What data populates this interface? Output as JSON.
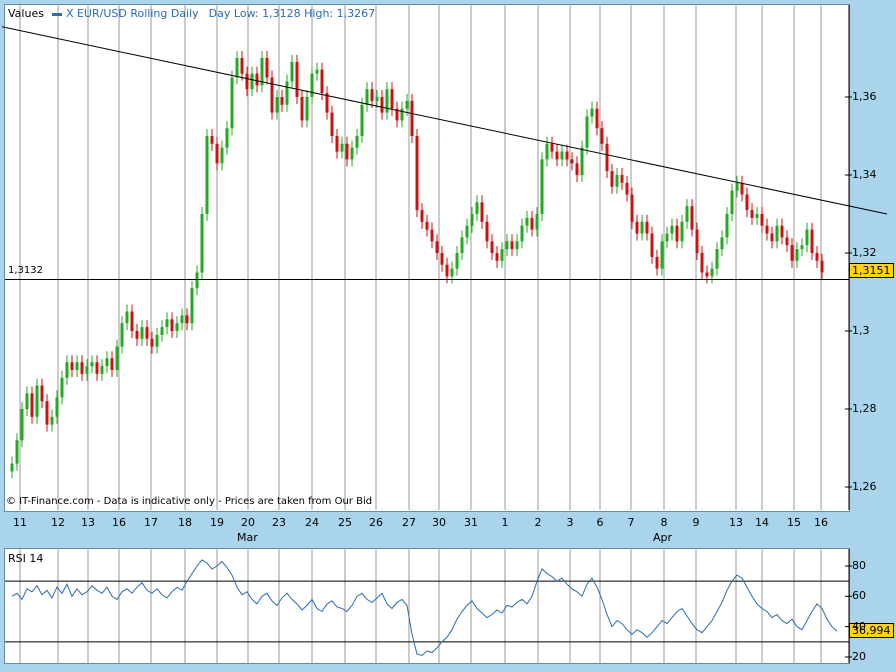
{
  "legend": {
    "title": "Values",
    "series": "X EUR/USD Rolling Daily",
    "day_info": "Day Low: 1,3128 High: 1,3267"
  },
  "footnote": "© IT-Finance.com - Data is indicative only - Prices are taken from Our Bid",
  "level_label": "1,3132",
  "last_price": "1,3151",
  "rsi": {
    "title": "RSI 14",
    "last": "36,994",
    "ticks": [
      "80",
      "60",
      "40",
      "20"
    ]
  },
  "colors": {
    "up": "#22aa22",
    "down": "#cc1111",
    "rsi_line": "#2a6cb0",
    "background": "#a9d4ec"
  },
  "chart_data": [
    {
      "type": "candlestick",
      "title": "X EUR/USD Rolling Daily",
      "yticks": [
        "1,36",
        "1,34",
        "1,32",
        "1,3",
        "1,28",
        "1,26"
      ],
      "ylim": [
        1.258,
        1.381
      ],
      "x_tick_labels": [
        "11",
        "12",
        "13",
        "16",
        "17",
        "18",
        "19",
        "20",
        "23",
        "24",
        "25",
        "26",
        "27",
        "30",
        "31",
        "1",
        "2",
        "3",
        "6",
        "7",
        "8",
        "9",
        "13",
        "14",
        "15",
        "16"
      ],
      "months": [
        "Mar",
        "Apr"
      ],
      "grid": true,
      "close_path": [
        [
          0,
          1.266
        ],
        [
          1,
          1.272
        ],
        [
          2,
          1.28
        ],
        [
          3,
          1.284
        ],
        [
          4,
          1.278
        ],
        [
          5,
          1.286
        ],
        [
          6,
          1.282
        ],
        [
          7,
          1.276
        ],
        [
          8,
          1.278
        ],
        [
          9,
          1.283
        ],
        [
          10,
          1.288
        ],
        [
          11,
          1.292
        ],
        [
          12,
          1.29
        ],
        [
          13,
          1.292
        ],
        [
          14,
          1.289
        ],
        [
          15,
          1.291
        ],
        [
          16,
          1.292
        ],
        [
          17,
          1.289
        ],
        [
          18,
          1.291
        ],
        [
          19,
          1.293
        ],
        [
          20,
          1.29
        ],
        [
          21,
          1.296
        ],
        [
          22,
          1.302
        ],
        [
          23,
          1.305
        ],
        [
          24,
          1.3
        ],
        [
          25,
          1.298
        ],
        [
          26,
          1.301
        ],
        [
          27,
          1.298
        ],
        [
          28,
          1.296
        ],
        [
          29,
          1.299
        ],
        [
          30,
          1.301
        ],
        [
          31,
          1.303
        ],
        [
          32,
          1.3
        ],
        [
          33,
          1.302
        ],
        [
          34,
          1.304
        ],
        [
          35,
          1.302
        ],
        [
          36,
          1.311
        ],
        [
          37,
          1.315
        ],
        [
          38,
          1.33
        ],
        [
          39,
          1.35
        ],
        [
          40,
          1.348
        ],
        [
          41,
          1.343
        ],
        [
          42,
          1.347
        ],
        [
          43,
          1.352
        ],
        [
          44,
          1.365
        ],
        [
          45,
          1.37
        ],
        [
          46,
          1.366
        ],
        [
          47,
          1.362
        ],
        [
          48,
          1.366
        ],
        [
          49,
          1.363
        ],
        [
          50,
          1.37
        ],
        [
          51,
          1.365
        ],
        [
          52,
          1.356
        ],
        [
          53,
          1.36
        ],
        [
          54,
          1.358
        ],
        [
          55,
          1.364
        ],
        [
          56,
          1.369
        ],
        [
          57,
          1.36
        ],
        [
          58,
          1.354
        ],
        [
          59,
          1.36
        ],
        [
          60,
          1.366
        ],
        [
          61,
          1.367
        ],
        [
          62,
          1.361
        ],
        [
          63,
          1.356
        ],
        [
          64,
          1.35
        ],
        [
          65,
          1.346
        ],
        [
          66,
          1.348
        ],
        [
          67,
          1.344
        ],
        [
          68,
          1.347
        ],
        [
          69,
          1.35
        ],
        [
          70,
          1.358
        ],
        [
          71,
          1.362
        ],
        [
          72,
          1.359
        ],
        [
          73,
          1.36
        ],
        [
          74,
          1.356
        ],
        [
          75,
          1.362
        ],
        [
          76,
          1.357
        ],
        [
          77,
          1.354
        ],
        [
          78,
          1.357
        ],
        [
          79,
          1.359
        ],
        [
          80,
          1.35
        ],
        [
          81,
          1.331
        ],
        [
          82,
          1.328
        ],
        [
          83,
          1.326
        ],
        [
          84,
          1.323
        ],
        [
          85,
          1.32
        ],
        [
          86,
          1.317
        ],
        [
          87,
          1.314
        ],
        [
          88,
          1.316
        ],
        [
          89,
          1.32
        ],
        [
          90,
          1.324
        ],
        [
          91,
          1.327
        ],
        [
          92,
          1.33
        ],
        [
          93,
          1.333
        ],
        [
          94,
          1.328
        ],
        [
          95,
          1.323
        ],
        [
          96,
          1.32
        ],
        [
          97,
          1.318
        ],
        [
          98,
          1.321
        ],
        [
          99,
          1.323
        ],
        [
          100,
          1.321
        ],
        [
          101,
          1.323
        ],
        [
          102,
          1.327
        ],
        [
          103,
          1.329
        ],
        [
          104,
          1.326
        ],
        [
          105,
          1.33
        ],
        [
          106,
          1.344
        ],
        [
          107,
          1.348
        ],
        [
          108,
          1.346
        ],
        [
          109,
          1.344
        ],
        [
          110,
          1.346
        ],
        [
          111,
          1.344
        ],
        [
          112,
          1.343
        ],
        [
          113,
          1.34
        ],
        [
          114,
          1.347
        ],
        [
          115,
          1.355
        ],
        [
          116,
          1.357
        ],
        [
          117,
          1.352
        ],
        [
          118,
          1.348
        ],
        [
          119,
          1.341
        ],
        [
          120,
          1.337
        ],
        [
          121,
          1.34
        ],
        [
          122,
          1.338
        ],
        [
          123,
          1.335
        ],
        [
          124,
          1.328
        ],
        [
          125,
          1.325
        ],
        [
          126,
          1.328
        ],
        [
          127,
          1.325
        ],
        [
          128,
          1.319
        ],
        [
          129,
          1.316
        ],
        [
          130,
          1.323
        ],
        [
          131,
          1.325
        ],
        [
          132,
          1.327
        ],
        [
          133,
          1.323
        ],
        [
          134,
          1.328
        ],
        [
          135,
          1.332
        ],
        [
          136,
          1.326
        ],
        [
          137,
          1.32
        ],
        [
          138,
          1.315
        ],
        [
          139,
          1.314
        ],
        [
          140,
          1.316
        ],
        [
          141,
          1.321
        ],
        [
          142,
          1.324
        ],
        [
          143,
          1.33
        ],
        [
          144,
          1.336
        ],
        [
          145,
          1.338
        ],
        [
          146,
          1.335
        ],
        [
          147,
          1.331
        ],
        [
          148,
          1.329
        ],
        [
          149,
          1.33
        ],
        [
          150,
          1.327
        ],
        [
          151,
          1.325
        ],
        [
          152,
          1.323
        ],
        [
          153,
          1.327
        ],
        [
          154,
          1.324
        ],
        [
          155,
          1.322
        ],
        [
          156,
          1.318
        ],
        [
          157,
          1.321
        ],
        [
          158,
          1.322
        ],
        [
          159,
          1.326
        ],
        [
          160,
          1.32
        ],
        [
          161,
          1.318
        ],
        [
          162,
          1.315
        ]
      ],
      "trendline": [
        [
          -2,
          1.378
        ],
        [
          175,
          1.33
        ]
      ],
      "horizontal_level": 1.3132,
      "last_value": 1.3151
    },
    {
      "type": "line",
      "title": "RSI 14",
      "yticks": [
        "80",
        "60",
        "40",
        "20"
      ],
      "ylim": [
        17,
        90
      ],
      "reference_lines": [
        70,
        30
      ],
      "values": [
        60,
        62,
        58,
        65,
        63,
        67,
        61,
        64,
        59,
        66,
        62,
        68,
        60,
        65,
        61,
        63,
        67,
        64,
        62,
        66,
        60,
        58,
        63,
        65,
        62,
        66,
        69,
        64,
        62,
        65,
        61,
        59,
        63,
        66,
        64,
        70,
        75,
        80,
        84,
        82,
        78,
        80,
        83,
        79,
        74,
        66,
        61,
        63,
        58,
        55,
        60,
        62,
        57,
        54,
        59,
        62,
        58,
        55,
        51,
        54,
        58,
        52,
        50,
        55,
        57,
        53,
        52,
        50,
        54,
        60,
        62,
        58,
        56,
        59,
        62,
        55,
        52,
        56,
        58,
        54,
        35,
        22,
        21,
        24,
        23,
        26,
        30,
        33,
        38,
        45,
        50,
        54,
        57,
        52,
        49,
        46,
        48,
        51,
        49,
        54,
        53,
        56,
        58,
        55,
        60,
        70,
        78,
        75,
        73,
        70,
        72,
        68,
        65,
        63,
        60,
        68,
        72,
        66,
        58,
        48,
        40,
        44,
        42,
        38,
        35,
        38,
        36,
        33,
        36,
        40,
        44,
        42,
        46,
        50,
        52,
        47,
        42,
        38,
        36,
        40,
        44,
        50,
        56,
        64,
        70,
        74,
        72,
        66,
        60,
        55,
        52,
        50,
        46,
        48,
        44,
        42,
        45,
        40,
        38,
        44,
        50,
        55,
        52,
        45,
        40,
        37
      ]
    }
  ]
}
